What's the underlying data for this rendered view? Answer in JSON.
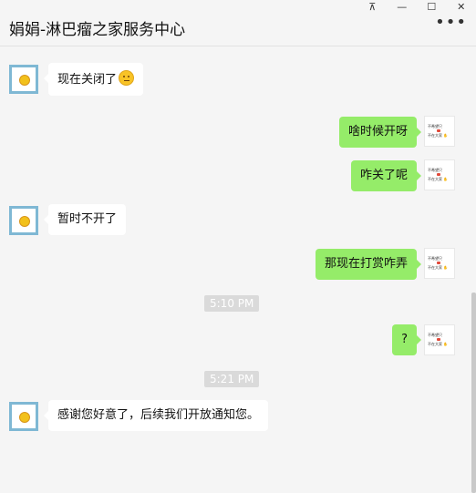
{
  "window": {
    "pin": "⊼",
    "minimize": "—",
    "maximize": "☐",
    "close": "✕"
  },
  "header": {
    "title": "娟娟-淋巴瘤之家服务中心",
    "more": "•••"
  },
  "self_avatar": {
    "line1": "不希望只",
    "line2": "不在大家 ✋"
  },
  "messages": [
    {
      "side": "in",
      "text": "现在关闭了",
      "emoji": "thinking-face-emoji"
    },
    {
      "side": "out",
      "text": "啥时候开呀"
    },
    {
      "side": "out",
      "text": "咋关了呢"
    },
    {
      "side": "in",
      "text": "暂时不开了"
    },
    {
      "side": "out",
      "text": "那现在打赏咋弄"
    },
    {
      "side": "time",
      "text": "5:10 PM"
    },
    {
      "side": "out",
      "text": "?"
    },
    {
      "side": "time",
      "text": "5:21 PM"
    },
    {
      "side": "in",
      "text": "感谢您好意了，后续我们开放通知您。"
    }
  ]
}
